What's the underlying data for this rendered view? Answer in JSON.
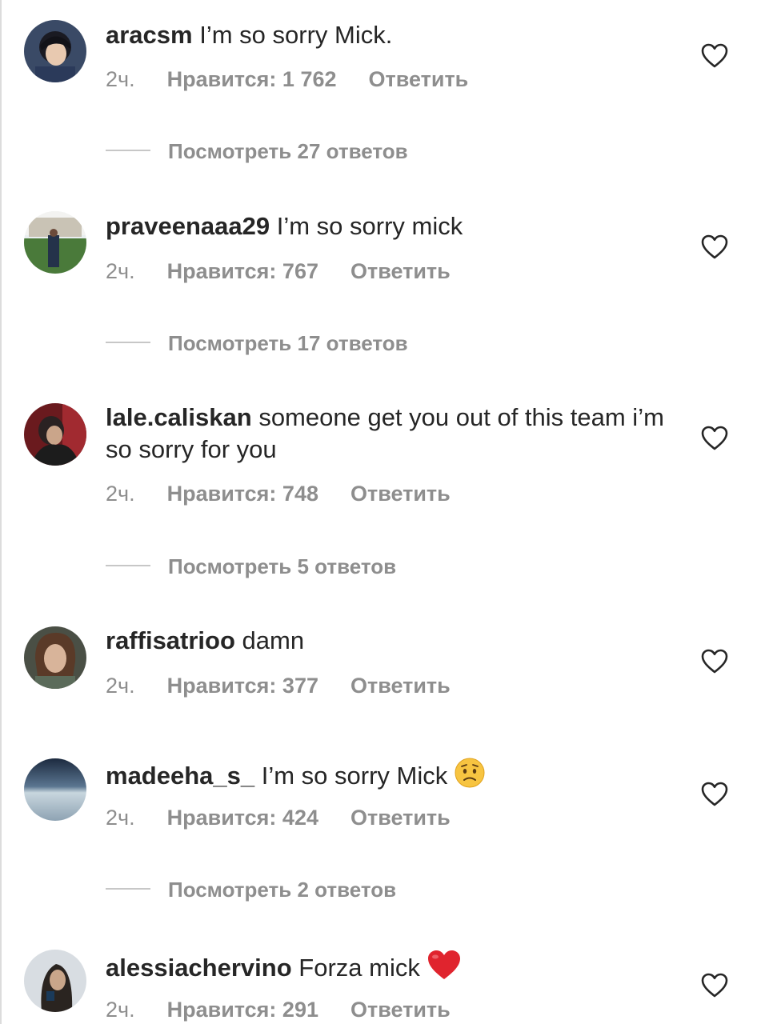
{
  "comments": [
    {
      "username": "aracsm",
      "text": "I’m so sorry Mick.",
      "time": "2ч.",
      "likes": "Нравится: 1 762",
      "reply": "Ответить",
      "replies": "Посмотреть 27 ответов"
    },
    {
      "username": "praveenaaa29",
      "text": "I’m so sorry mick",
      "time": "2ч.",
      "likes": "Нравится: 767",
      "reply": "Ответить",
      "replies": "Посмотреть 17 ответов"
    },
    {
      "username": "lale.caliskan",
      "text": "someone get you out of this team i’m so sorry for you",
      "time": "2ч.",
      "likes": "Нравится: 748",
      "reply": "Ответить",
      "replies": "Посмотреть 5 ответов"
    },
    {
      "username": "raffisatrioo",
      "text": "damn",
      "time": "2ч.",
      "likes": "Нравится: 377",
      "reply": "Ответить"
    },
    {
      "username": "madeeha_s_",
      "text": "I’m so sorry Mick",
      "emoji": "worried-face-emoji",
      "time": "2ч.",
      "likes": "Нравится: 424",
      "reply": "Ответить",
      "replies": "Посмотреть 2 ответов"
    },
    {
      "username": "alessiachervino",
      "text": "Forza mick",
      "emoji": "red-heart-emoji",
      "time": "2ч.",
      "likes": "Нравится: 291",
      "reply": "Ответить"
    }
  ],
  "icons": {
    "like": "heart-outline-icon"
  },
  "colors": {
    "text": "#262626",
    "secondary": "#8e8e8e",
    "heart_emoji": "#e0242e"
  }
}
